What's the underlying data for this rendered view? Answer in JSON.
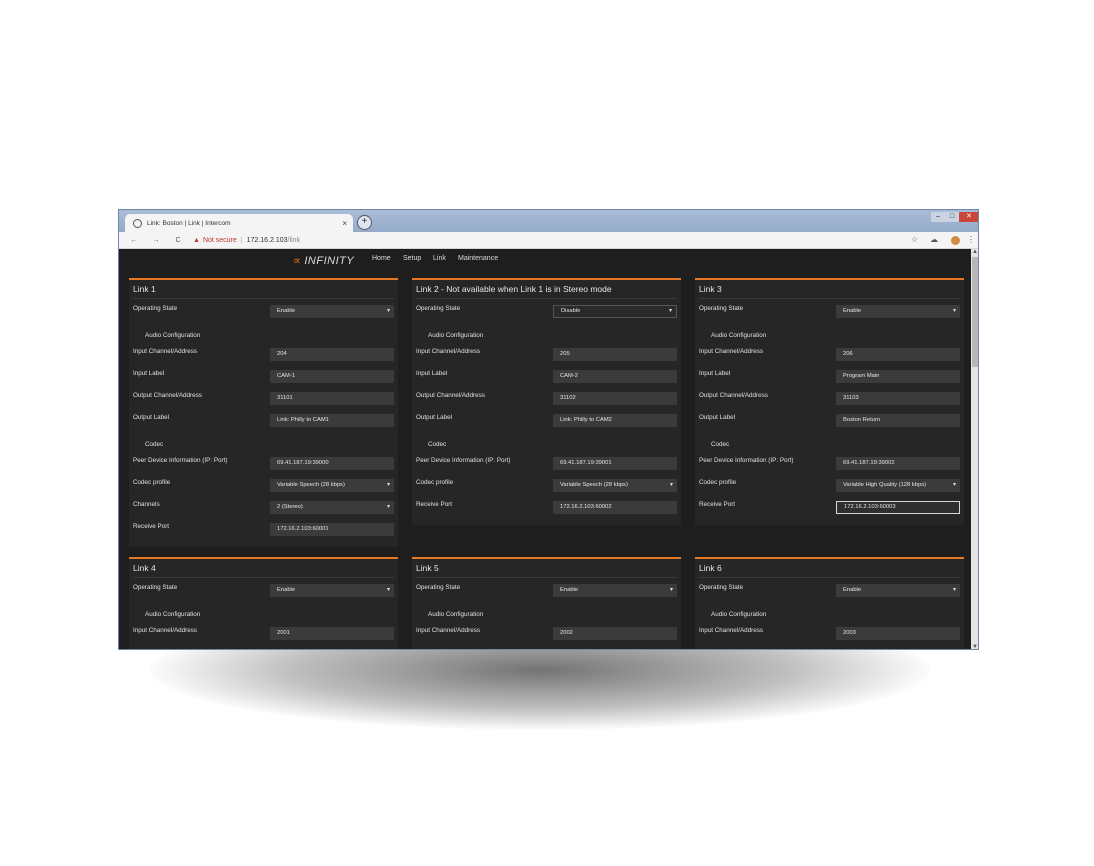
{
  "browser": {
    "tab_title": "Link: Boston | Link | Intercom",
    "tab_close": "×",
    "new_tab": "+",
    "controls": {
      "minimize": "–",
      "maximize": "□",
      "close": "✕"
    },
    "address": {
      "back": "←",
      "forward": "→",
      "reload": "C",
      "warning_icon": "▲",
      "not_secure": "Not secure",
      "separator": "|",
      "host": "172.16.2.103",
      "path": "/link",
      "star": "☆",
      "menu": "⋮"
    }
  },
  "app": {
    "logo_mark": "∝",
    "logo_text": "INFINITY",
    "menu": [
      "Home",
      "Setup",
      "Link",
      "Maintenance"
    ]
  },
  "labels": {
    "operating_state": "Operating State",
    "audio_configuration": "Audio Configuration",
    "input_channel": "Input Channel/Address",
    "input_label": "Input Label",
    "output_channel": "Output Channel/Address",
    "output_label": "Output Label",
    "codec": "Codec",
    "peer_device": "Peer Device Information (IP: Port)",
    "codec_profile": "Codec profile",
    "channels": "Channels",
    "receive_port": "Receive Port"
  },
  "links": [
    {
      "title": "Link 1",
      "operating_state": "Enable",
      "input_channel": "204",
      "input_label": "CAM-1",
      "output_channel": "31101",
      "output_label": "Link: Philly to CAM1",
      "peer_device": "69.41.187.19:39000",
      "codec_profile": "Variable Speech (28 kbps)",
      "channels": "2 (Stereo)",
      "receive_port": "172.16.2.103:60001"
    },
    {
      "title": "Link 2 - Not available when Link 1 is in Stereo mode",
      "operating_state": "Disable",
      "input_channel": "205",
      "input_label": "CAM-2",
      "output_channel": "31102",
      "output_label": "Link: Philly to CAM2",
      "peer_device": "69.41.187.19:39001",
      "codec_profile": "Variable Speech (28 kbps)",
      "receive_port": "172.16.2.103:60002"
    },
    {
      "title": "Link 3",
      "operating_state": "Enable",
      "input_channel": "206",
      "input_label": "Program Main",
      "output_channel": "31103",
      "output_label": "Boston Return",
      "peer_device": "69.41.187.19:39002",
      "codec_profile": "Variable High Quality (128 kbps)",
      "receive_port": "172.16.2.103:60003"
    },
    {
      "title": "Link 4",
      "operating_state": "Enable",
      "input_channel": "2001"
    },
    {
      "title": "Link 5",
      "operating_state": "Enable",
      "input_channel": "2002"
    },
    {
      "title": "Link 6",
      "operating_state": "Enable",
      "input_channel": "2003"
    }
  ]
}
